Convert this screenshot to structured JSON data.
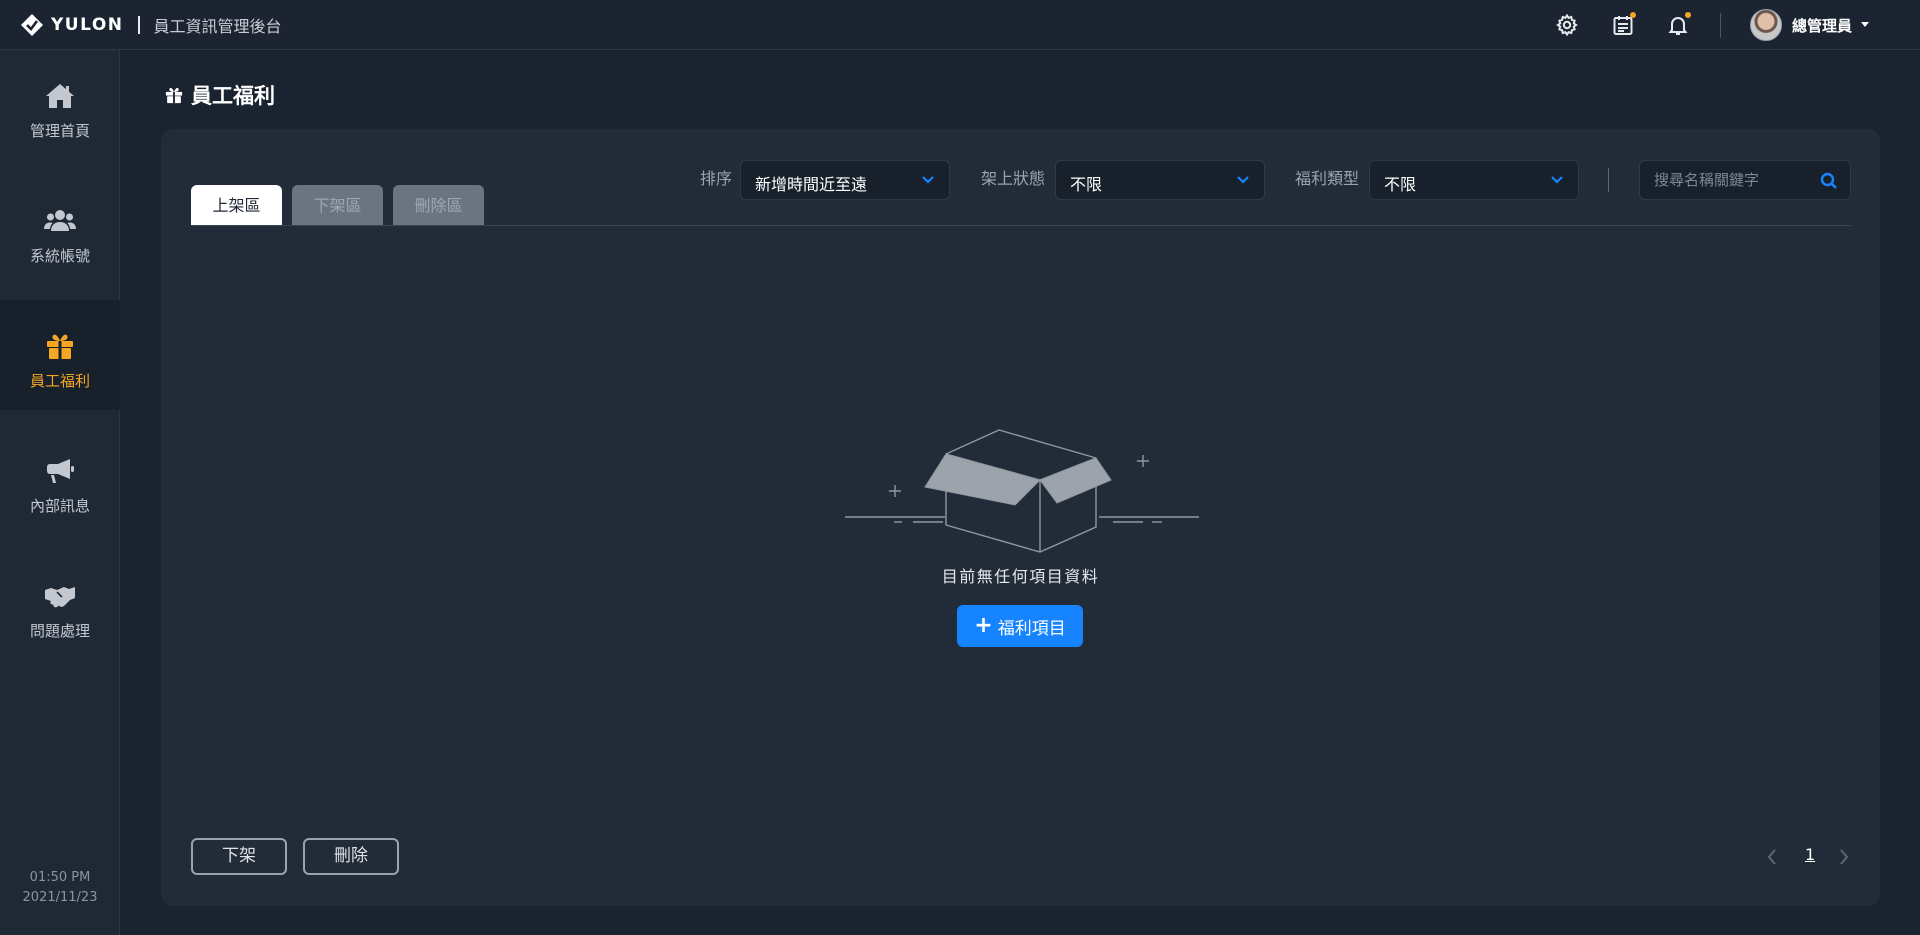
{
  "header": {
    "brand": "YULON",
    "app_title": "員工資訊管理後台",
    "user_name": "總管理員",
    "icons": [
      "gear-icon",
      "calendar-icon",
      "bell-icon"
    ],
    "accent_color": "#f5a623"
  },
  "sidebar": {
    "items": [
      {
        "label": "管理首頁",
        "icon": "home-icon",
        "active": false
      },
      {
        "label": "系統帳號",
        "icon": "users-icon",
        "active": false
      },
      {
        "label": "員工福利",
        "icon": "gift-icon",
        "active": true
      },
      {
        "label": "內部訊息",
        "icon": "megaphone-icon",
        "active": false
      },
      {
        "label": "問題處理",
        "icon": "handshake-icon",
        "active": false
      }
    ],
    "time": "01:50 PM",
    "date": "2021/11/23"
  },
  "page": {
    "title": "員工福利"
  },
  "tabs": [
    {
      "label": "上架區",
      "active": true
    },
    {
      "label": "下架區",
      "active": false
    },
    {
      "label": "刪除區",
      "active": false
    }
  ],
  "filters": {
    "sort_label": "排序",
    "sort_value": "新增時間近至遠",
    "status_label": "架上狀態",
    "status_value": "不限",
    "type_label": "福利類型",
    "type_value": "不限",
    "search_placeholder": "搜尋名稱關鍵字"
  },
  "empty": {
    "message": "目前無任何項目資料",
    "add_button": "福利項目"
  },
  "actions": {
    "unpublish": "下架",
    "delete": "刪除"
  },
  "pagination": {
    "current": "1"
  },
  "colors": {
    "primary": "#1684ff",
    "active_nav": "#f5a623",
    "background": "#1a2330"
  }
}
